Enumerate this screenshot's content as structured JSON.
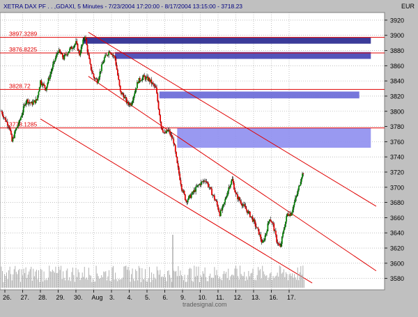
{
  "chart_data": {
    "type": "candlestick",
    "title": "XETRA DAX PF . . ,GDAXI, 5 Minutes - 7/23/2004 17:20:00 - 8/17/2004 13:15:00 - 3718.23",
    "currency": "EUR",
    "watermark": "tradesignal.com",
    "y_axis": {
      "ylim": [
        3565,
        3930
      ],
      "ticks": [
        3580,
        3600,
        3620,
        3640,
        3660,
        3680,
        3700,
        3720,
        3740,
        3760,
        3780,
        3800,
        3820,
        3840,
        3860,
        3880,
        3900,
        3920
      ]
    },
    "x_axis": {
      "labels": [
        "26.",
        "27.",
        "28.",
        "29.",
        "30.",
        "Aug",
        "3.",
        "4.",
        "5.",
        "6.",
        "9.",
        "10.",
        "11.",
        "12.",
        "13.",
        "16.",
        "17."
      ],
      "label_index": [
        0,
        1,
        2,
        3,
        4,
        5,
        6,
        7,
        8,
        9,
        10,
        11,
        12,
        13,
        14,
        15,
        16
      ]
    },
    "price_path": [
      [
        -0.2,
        3800
      ],
      [
        0.0,
        3790
      ],
      [
        0.25,
        3780
      ],
      [
        0.4,
        3760
      ],
      [
        0.6,
        3775
      ],
      [
        0.8,
        3785
      ],
      [
        1.0,
        3800
      ],
      [
        1.2,
        3815
      ],
      [
        1.5,
        3810
      ],
      [
        1.8,
        3815
      ],
      [
        2.0,
        3840
      ],
      [
        2.3,
        3830
      ],
      [
        2.7,
        3860
      ],
      [
        3.0,
        3880
      ],
      [
        3.3,
        3870
      ],
      [
        3.6,
        3880
      ],
      [
        4.0,
        3890
      ],
      [
        4.2,
        3875
      ],
      [
        4.5,
        3900
      ],
      [
        4.8,
        3860
      ],
      [
        5.0,
        3845
      ],
      [
        5.2,
        3840
      ],
      [
        5.6,
        3870
      ],
      [
        5.9,
        3880
      ],
      [
        6.2,
        3870
      ],
      [
        6.5,
        3825
      ],
      [
        6.7,
        3820
      ],
      [
        6.9,
        3810
      ],
      [
        7.1,
        3810
      ],
      [
        7.3,
        3825
      ],
      [
        7.5,
        3840
      ],
      [
        7.8,
        3845
      ],
      [
        8.1,
        3842
      ],
      [
        8.5,
        3830
      ],
      [
        8.8,
        3780
      ],
      [
        9.0,
        3770
      ],
      [
        9.2,
        3775
      ],
      [
        9.5,
        3760
      ],
      [
        9.7,
        3730
      ],
      [
        9.95,
        3700
      ],
      [
        10.2,
        3682
      ],
      [
        10.5,
        3690
      ],
      [
        10.8,
        3700
      ],
      [
        11.0,
        3705
      ],
      [
        11.3,
        3710
      ],
      [
        11.6,
        3695
      ],
      [
        11.9,
        3680
      ],
      [
        12.1,
        3665
      ],
      [
        12.3,
        3675
      ],
      [
        12.6,
        3700
      ],
      [
        12.8,
        3710
      ],
      [
        13.0,
        3690
      ],
      [
        13.3,
        3680
      ],
      [
        13.6,
        3670
      ],
      [
        13.9,
        3660
      ],
      [
        14.1,
        3650
      ],
      [
        14.3,
        3640
      ],
      [
        14.5,
        3625
      ],
      [
        14.7,
        3640
      ],
      [
        14.9,
        3660
      ],
      [
        15.1,
        3650
      ],
      [
        15.3,
        3630
      ],
      [
        15.5,
        3620
      ],
      [
        15.7,
        3645
      ],
      [
        15.9,
        3665
      ],
      [
        16.1,
        3665
      ],
      [
        16.3,
        3680
      ],
      [
        16.5,
        3695
      ],
      [
        16.7,
        3715
      ],
      [
        16.85,
        3722
      ]
    ],
    "horizontal_levels": [
      {
        "label": "3897.3289",
        "value": 3897.3289
      },
      {
        "label": "3876.8225",
        "value": 3876.8225
      },
      {
        "label": "3828.72",
        "value": 3828.72
      },
      {
        "label": "3778.1285",
        "value": 3778.1285
      }
    ],
    "zones": [
      {
        "x_start": 4.4,
        "x_end": 20.6,
        "y_low": 3889,
        "y_high": 3897,
        "color": "#2a2a90"
      },
      {
        "x_start": 6.2,
        "x_end": 20.6,
        "y_low": 3869,
        "y_high": 3878,
        "color": "#4444b4"
      },
      {
        "x_start": 8.7,
        "x_end": 19.95,
        "y_low": 3817,
        "y_high": 3826,
        "color": "#6a6ad8"
      },
      {
        "x_start": 9.7,
        "x_end": 20.6,
        "y_low": 3752,
        "y_high": 3778,
        "color": "#9090f0"
      }
    ],
    "trend_lines": [
      {
        "from": [
          4.7,
          3904
        ],
        "to": [
          20.9,
          3675
        ]
      },
      {
        "from": [
          4.7,
          3846
        ],
        "to": [
          20.9,
          3590
        ]
      },
      {
        "from": [
          2.0,
          3790
        ],
        "to": [
          17.3,
          3574
        ]
      }
    ],
    "volume_spikes": [
      {
        "x": 9.45,
        "level": 0.95
      }
    ]
  }
}
